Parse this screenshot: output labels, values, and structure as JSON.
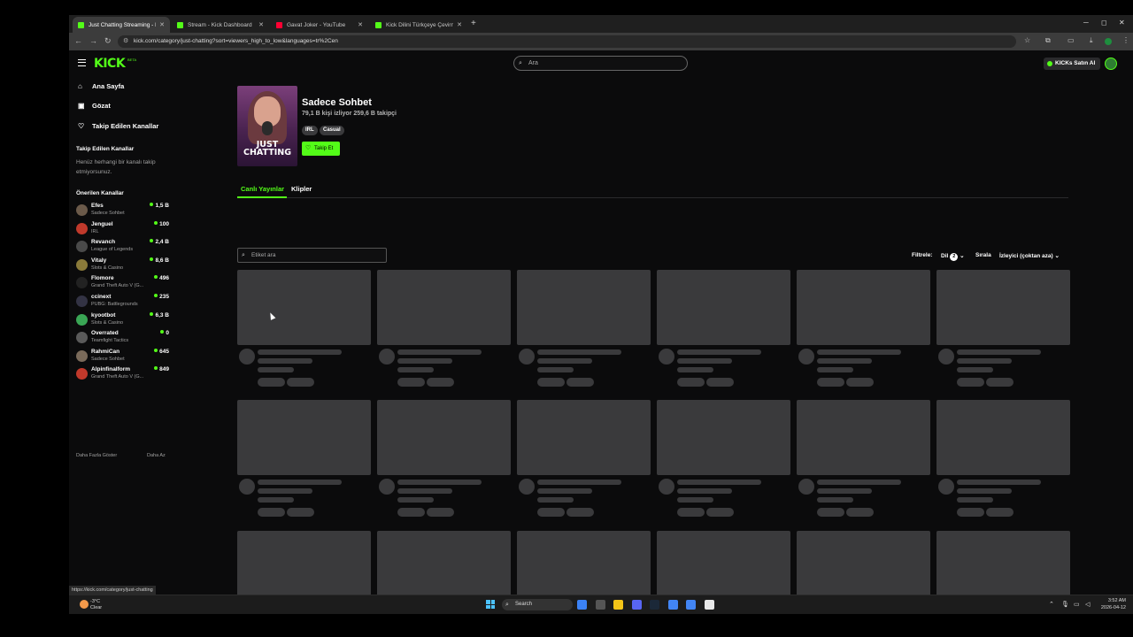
{
  "browser": {
    "tabs": [
      {
        "title": "Just Chatting Streaming - Live",
        "favicon_color": "#53fc18",
        "active": true
      },
      {
        "title": "Stream - Kick Dashboard",
        "favicon_color": "#53fc18",
        "active": false
      },
      {
        "title": "Gavat Joker - YouTube",
        "favicon_color": "#ff0033",
        "active": false
      },
      {
        "title": "Kick Dilini Türkçeye Çevirme -",
        "favicon_color": "#53fc18",
        "active": false
      }
    ],
    "new_tab": "+",
    "url": "kick.com/category/just-chatting?sort=viewers_high_to_low&languages=tr%2Cen",
    "status_url": "https://kick.com/category/just-chatting"
  },
  "header": {
    "logo": "KICK",
    "logo_sup": "BETA",
    "search_placeholder": "Ara",
    "kicks_button": "KICKs Satın Al"
  },
  "sidebar": {
    "nav": [
      {
        "label": "Ana Sayfa",
        "icon": "home-icon",
        "glyph": "⌂"
      },
      {
        "label": "Gözat",
        "icon": "browse-icon",
        "glyph": "▣"
      },
      {
        "label": "Takip Edilen Kanallar",
        "icon": "heart-icon",
        "glyph": "♡"
      }
    ],
    "followed_heading": "Takip Edilen Kanallar",
    "followed_empty": "Henüz herhangi bir kanalı takip etmiyorsunuz.",
    "recommended_heading": "Önerilen Kanallar",
    "recommended": [
      {
        "name": "Efes",
        "category": "Sadece Sohbet",
        "viewers": "1,5 B",
        "avatar_color": "#6b5a4a"
      },
      {
        "name": "Jenguel",
        "category": "IRL",
        "viewers": "100",
        "avatar_color": "#c0392b"
      },
      {
        "name": "Revanch",
        "category": "League of Legends",
        "viewers": "2,4 B",
        "avatar_color": "#4a4a4a"
      },
      {
        "name": "Vitaly",
        "category": "Slots & Casino",
        "viewers": "8,6 B",
        "avatar_color": "#8a7a3a"
      },
      {
        "name": "Flomore",
        "category": "Grand Theft Auto V (G...",
        "viewers": "496",
        "avatar_color": "#222222"
      },
      {
        "name": "ccinext",
        "category": "PUBG: Battlegrounds",
        "viewers": "235",
        "avatar_color": "#333344"
      },
      {
        "name": "kyootbot",
        "category": "Slots & Casino",
        "viewers": "6,3 B",
        "avatar_color": "#3aa655"
      },
      {
        "name": "Overrated",
        "category": "Teamfight Tactics",
        "viewers": "0",
        "avatar_color": "#5a5a5a"
      },
      {
        "name": "RahmiCan",
        "category": "Sadece Sohbet",
        "viewers": "645",
        "avatar_color": "#7a6a5a"
      },
      {
        "name": "Alpinfinalform",
        "category": "Grand Theft Auto V (G...",
        "viewers": "849",
        "avatar_color": "#c0392b"
      }
    ],
    "show_more": "Daha Fazla Göster",
    "show_less": "Daha Az"
  },
  "category": {
    "cover_text_1": "JUST",
    "cover_text_2": "CHATTING",
    "title": "Sadece Sohbet",
    "stats": "79,1 B kişi izliyor  259,6 B takipçi",
    "tags": [
      "IRL",
      "Casual"
    ],
    "follow_label": "Takip Et"
  },
  "tabs": {
    "live": "Canlı Yayınlar",
    "clips": "Klipler"
  },
  "filters": {
    "tag_search_placeholder": "Etiket ara",
    "filter_label": "Filtrele:",
    "language_label": "Dil",
    "language_count": "2",
    "sort_label": "Sırala",
    "sort_value": "İzleyici (çoktan aza)"
  },
  "taskbar": {
    "weather_temp": "-3°C",
    "weather_desc": "Clear",
    "search_label": "Search",
    "time": "3:52 AM",
    "date": "2026-04-12",
    "app_colors": [
      "#3b82f6",
      "#555555",
      "#f5c518",
      "#5865f2",
      "#1b2838",
      "#4285f4",
      "#4285f4",
      "#e8e8e8"
    ]
  }
}
